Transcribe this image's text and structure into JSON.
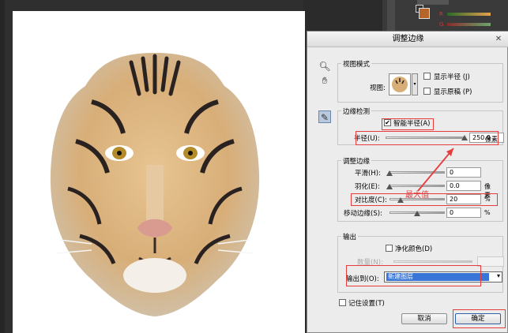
{
  "panel": {
    "slider_labels": [
      "R",
      "G",
      "B"
    ],
    "top_text": "色板"
  },
  "dialog": {
    "title": "调整边缘",
    "view_mode": {
      "section": "视图模式",
      "view_label": "视图:",
      "show_radius": "显示半径 (J)",
      "show_original": "显示原稿 (P)"
    },
    "edge_detection": {
      "section": "边缘检测",
      "smart_radius": "智能半径(A)",
      "smart_radius_checked": true,
      "radius_label": "半径(U):",
      "radius_value": "250.0",
      "radius_unit": "像素",
      "radius_level": 1.0
    },
    "adjust_edge": {
      "section": "调整边缘",
      "rows": [
        {
          "label": "平滑(H):",
          "value": "0",
          "unit": "",
          "level": 0.0
        },
        {
          "label": "羽化(E):",
          "value": "0.0",
          "unit": "像素",
          "level": 0.0
        },
        {
          "label": "对比度(C):",
          "value": "20",
          "unit": "%",
          "level": 0.2
        },
        {
          "label": "移动边缘(S):",
          "value": "0",
          "unit": "%",
          "level": 0.5
        }
      ]
    },
    "output": {
      "section": "输出",
      "decontaminate": "净化颜色(D)",
      "amount_label": "数量(N):",
      "output_to_label": "输出到(O):",
      "output_to_value": "新建图层"
    },
    "remember": "记住设置(T)",
    "cancel": "取消",
    "ok": "确定"
  },
  "annotation": {
    "text": "最大值",
    "color": "#e83c3c"
  }
}
